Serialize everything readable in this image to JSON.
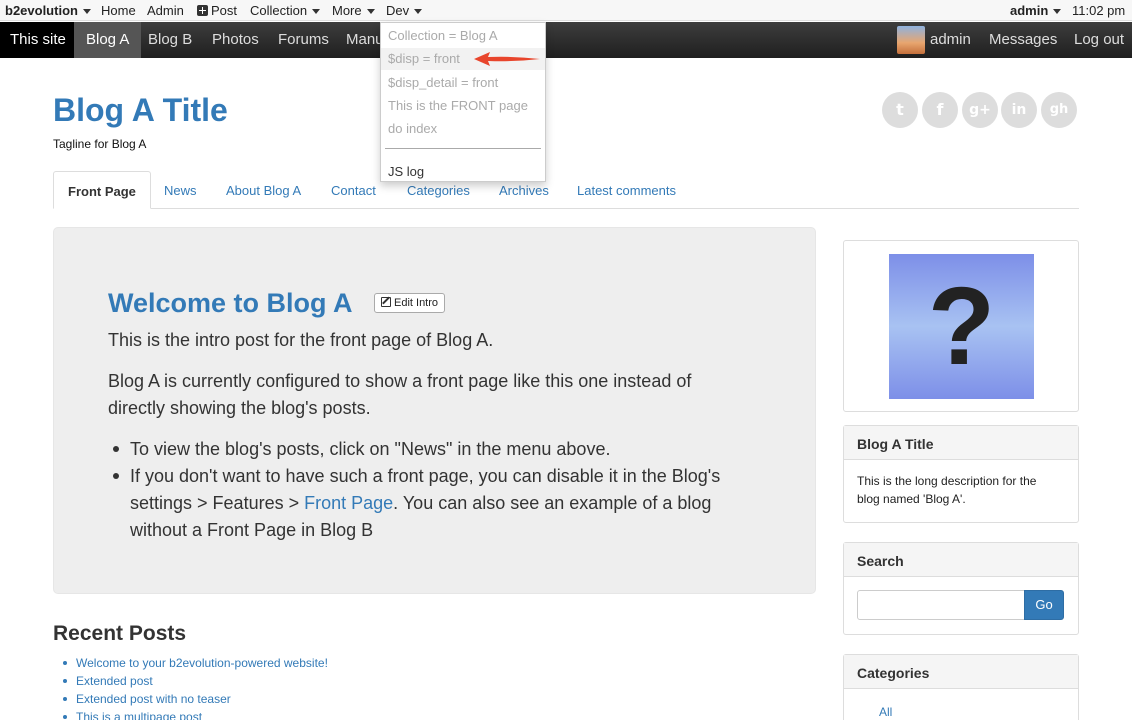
{
  "admin_bar": {
    "brand": "b2evolution",
    "home": "Home",
    "admin": "Admin",
    "post": "Post",
    "collection": "Collection",
    "more": "More",
    "dev": "Dev",
    "user": "admin",
    "time": "11:02 pm"
  },
  "site_bar": {
    "this_site": "This site",
    "items": [
      "Blog A",
      "Blog B",
      "Photos",
      "Forums",
      "Manu"
    ],
    "user": "admin",
    "messages": "Messages",
    "logout": "Log out"
  },
  "dev_menu": {
    "items": [
      "Collection = Blog A",
      "$disp = front",
      "$disp_detail = front",
      "This is the FRONT page",
      "do index"
    ],
    "js_log": "JS log",
    "annotation_color": "#e8452c"
  },
  "header": {
    "title": "Blog A Title",
    "tagline": "Tagline for Blog A",
    "social_icons": [
      "twitter-icon",
      "facebook-icon",
      "google-plus-icon",
      "linkedin-icon",
      "github-icon"
    ],
    "social_glyphs": [
      "t",
      "f",
      "g+",
      "in",
      "gh"
    ]
  },
  "tabs": [
    "Front Page",
    "News",
    "About Blog A",
    "Contact",
    "Categories",
    "Archives",
    "Latest comments"
  ],
  "intro": {
    "title": "Welcome to Blog A",
    "edit_label": "Edit Intro",
    "p1": "This is the intro post for the front page of Blog A.",
    "p2a": "Blog A is currently configured to show a front page like this one instead of",
    "p2b": "directly showing the blog's posts.",
    "li1": "To view the blog's posts, click on \"News\" in the menu above.",
    "li2a": "If you don't want to have such a front page, you can disable it in the Blog's",
    "li2b_pre": "settings > Features > ",
    "li2b_link": "Front Page",
    "li2b_post": ". You can also see an example of a blog",
    "li2c": "without a Front Page in Blog B"
  },
  "recent_posts": {
    "title": "Recent Posts",
    "items": [
      "Welcome to your b2evolution-powered website!",
      "Extended post",
      "Extended post with no teaser",
      "This is a multipage post"
    ]
  },
  "sidebar": {
    "avatar_glyph": "?",
    "blog_title": "Blog A Title",
    "description_1": "This is the long description for the",
    "description_2": "blog named 'Blog A'.",
    "search_title": "Search",
    "search_button": "Go",
    "categories_title": "Categories",
    "categories": [
      "All"
    ]
  },
  "colors": {
    "link": "#337ab7",
    "toolbar_dark": "#1f1f1f",
    "panel_bg": "#eeeeee"
  }
}
